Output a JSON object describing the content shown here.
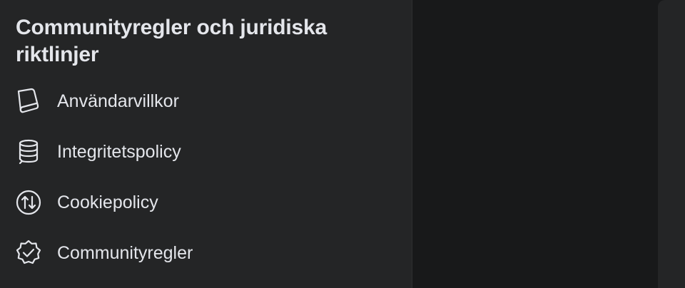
{
  "legal_section": {
    "title": "Communityregler och juridiska riktlinjer",
    "items": [
      {
        "label": "Användarvillkor",
        "icon": "book-icon"
      },
      {
        "label": "Integritetspolicy",
        "icon": "database-icon"
      },
      {
        "label": "Cookiepolicy",
        "icon": "sort-arrows-icon"
      },
      {
        "label": "Communityregler",
        "icon": "verified-badge-icon"
      }
    ]
  },
  "colors": {
    "panel_background": "#242526",
    "page_background": "#18191a",
    "text_primary": "#e4e6eb"
  }
}
